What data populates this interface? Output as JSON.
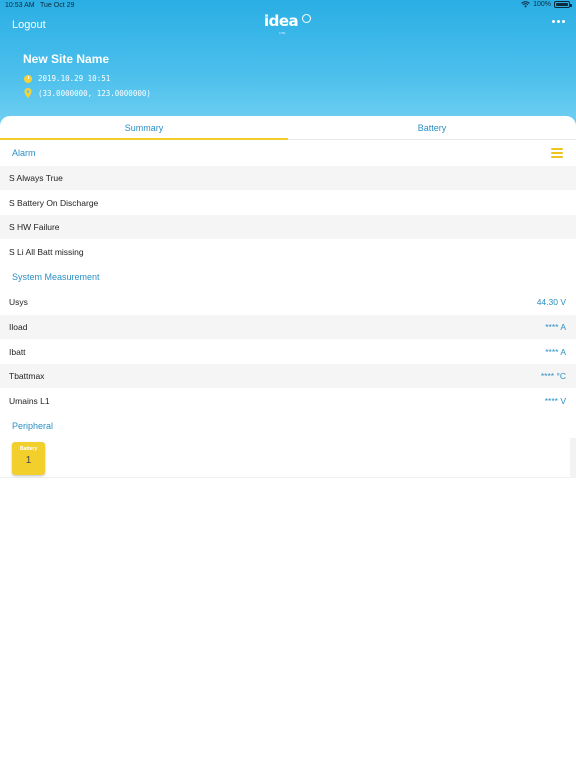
{
  "status_bar": {
    "time": "10:53 AM",
    "date": "Tue Oct 29",
    "battery": "100%"
  },
  "header": {
    "logout_label": "Logout",
    "logo_text": "idea",
    "logo_sub": "LITE",
    "site_name": "New Site Name",
    "datetime": "2019.10.29 10:51",
    "coordinates": "(33.0000000, 123.0000000)"
  },
  "tabs": [
    {
      "label": "Summary",
      "active": true
    },
    {
      "label": "Battery",
      "active": false
    }
  ],
  "alarm": {
    "title": "Alarm",
    "items": [
      "S Always True",
      "S Battery On Discharge",
      "S HW Failure",
      "S Li All Batt missing"
    ]
  },
  "measurement": {
    "title": "System Measurement",
    "rows": [
      {
        "label": "Usys",
        "value": "44.30 V"
      },
      {
        "label": "Iload",
        "value": "**** A"
      },
      {
        "label": "Ibatt",
        "value": "**** A"
      },
      {
        "label": "Tbattmax",
        "value": "**** °C"
      },
      {
        "label": "Umains L1",
        "value": "**** V"
      }
    ]
  },
  "peripheral": {
    "title": "Peripheral",
    "tiles": [
      {
        "label": "Battery",
        "count": "1"
      }
    ]
  },
  "colors": {
    "accent": "#2b8fc5",
    "highlight": "#f1cd2e",
    "header_top": "#2aaee4"
  }
}
